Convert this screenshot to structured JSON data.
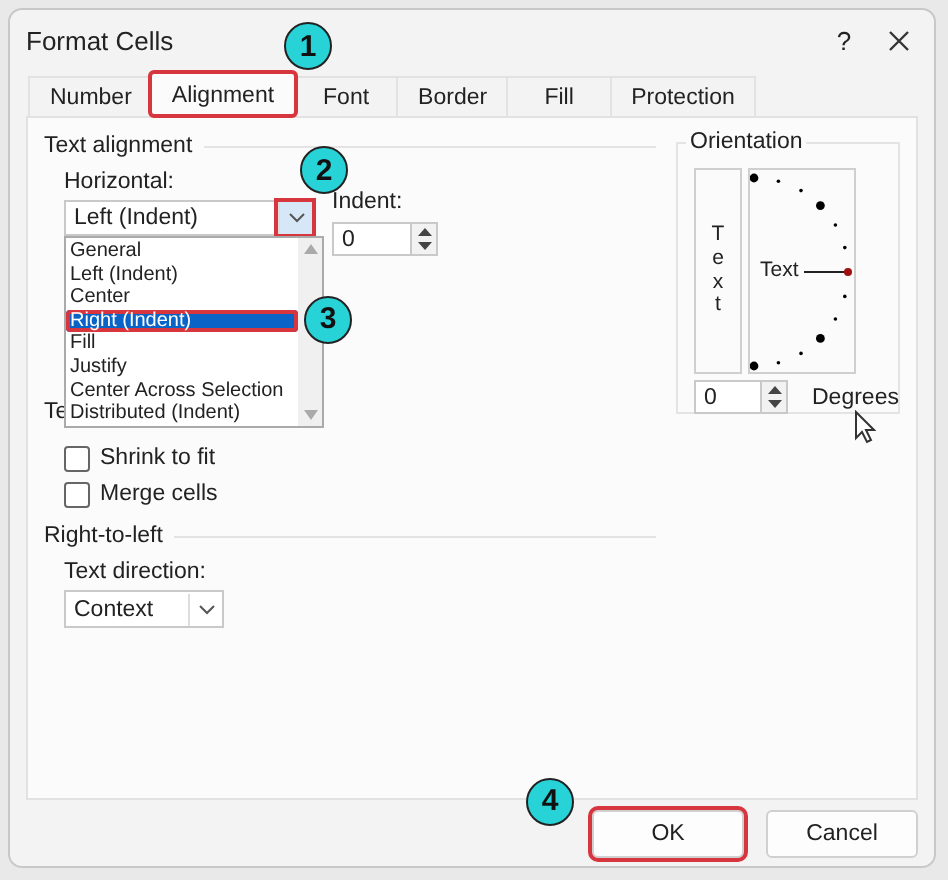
{
  "window": {
    "title": "Format Cells",
    "help": "?"
  },
  "tabs": [
    {
      "label": "Number",
      "selected": false,
      "highlighted": false
    },
    {
      "label": "Alignment",
      "selected": true,
      "highlighted": true,
      "callout": "1"
    },
    {
      "label": "Font",
      "selected": false,
      "highlighted": false
    },
    {
      "label": "Border",
      "selected": false,
      "highlighted": false
    },
    {
      "label": "Fill",
      "selected": false,
      "highlighted": false
    },
    {
      "label": "Protection",
      "selected": false,
      "highlighted": false
    }
  ],
  "text_alignment": {
    "title": "Text alignment",
    "horizontal": {
      "label": "Horizontal:",
      "value": "Left (Indent)",
      "expanded": true,
      "arrow_highlighted": true,
      "callout": "2"
    },
    "indent": {
      "label": "Indent:",
      "value": "0"
    },
    "options": [
      {
        "label": "General",
        "selected": false,
        "highlighted": false
      },
      {
        "label": "Left (Indent)",
        "selected": false,
        "highlighted": false
      },
      {
        "label": "Center",
        "selected": false,
        "highlighted": false
      },
      {
        "label": "Right (Indent)",
        "selected": true,
        "highlighted": true,
        "callout": "3"
      },
      {
        "label": "Fill",
        "selected": false,
        "highlighted": false
      },
      {
        "label": "Justify",
        "selected": false,
        "highlighted": false
      },
      {
        "label": "Center Across Selection",
        "selected": false,
        "highlighted": false
      },
      {
        "label": "Distributed (Indent)",
        "selected": false,
        "highlighted": false
      }
    ]
  },
  "text_control": {
    "title": "Te",
    "checkboxes": [
      {
        "label": "Shrink to fit",
        "checked": false
      },
      {
        "label": "Merge cells",
        "checked": false
      }
    ]
  },
  "right_to_left": {
    "title": "Right-to-left",
    "text_direction": {
      "label": "Text direction:",
      "value": "Context"
    }
  },
  "orientation": {
    "title": "Orientation",
    "vertical_text": "Text",
    "dial_text": "Text",
    "degrees": {
      "value": "0",
      "label": "Degrees"
    }
  },
  "buttons": [
    {
      "label": "OK",
      "highlighted": true,
      "callout": "4"
    },
    {
      "label": "Cancel",
      "highlighted": false
    }
  ]
}
